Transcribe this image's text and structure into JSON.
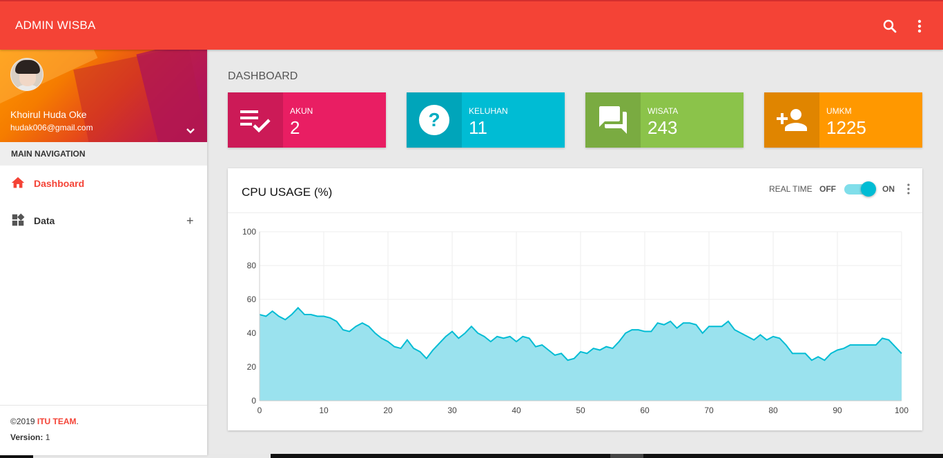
{
  "topbar": {
    "title": "ADMIN WISBA",
    "search_icon": "search-icon",
    "more_icon": "more-vert-icon",
    "bg_color": "#f44336"
  },
  "sidebar": {
    "user": {
      "name": "Khoirul Huda Oke",
      "email": "hudak006@gmail.com"
    },
    "nav_header": "MAIN NAVIGATION",
    "items": [
      {
        "label": "Dashboard",
        "icon": "home-icon",
        "active": true
      },
      {
        "label": "Data",
        "icon": "widgets-icon",
        "expand": "+"
      }
    ],
    "legal": {
      "copyright": "©2019 ",
      "brand": "ITU TEAM",
      "period": ".",
      "version_label": "Version:",
      "version_value": " 1"
    }
  },
  "main": {
    "page_title": "DASHBOARD",
    "info_boxes": [
      {
        "label": "AKUN",
        "value": "2",
        "color": "#e91e63",
        "icon": "playlist-check-icon"
      },
      {
        "label": "KELUHAN",
        "value": "11",
        "color": "#00bcd4",
        "icon": "help-icon"
      },
      {
        "label": "WISATA",
        "value": "243",
        "color": "#8bc34a",
        "icon": "forum-icon"
      },
      {
        "label": "UMKM",
        "value": "1225",
        "color": "#ff9800",
        "icon": "person-add-icon"
      }
    ],
    "cpu_card": {
      "title": "CPU USAGE (%)",
      "realtime_label": "REAL TIME",
      "off_label": "OFF",
      "on_label": "ON",
      "switch_on": true
    }
  },
  "chart_data": {
    "type": "area",
    "title": "",
    "xlabel": "",
    "ylabel": "",
    "xlim": [
      0,
      100
    ],
    "ylim": [
      0,
      100
    ],
    "x_ticks": [
      0,
      10,
      20,
      30,
      40,
      50,
      60,
      70,
      80,
      90,
      100
    ],
    "y_ticks": [
      0,
      20,
      40,
      60,
      80,
      100
    ],
    "grid": true,
    "color": "#00bcd4",
    "fill_color": "#9ae2ee",
    "x": [
      0,
      1,
      2,
      3,
      4,
      5,
      6,
      7,
      8,
      9,
      10,
      11,
      12,
      13,
      14,
      15,
      16,
      17,
      18,
      19,
      20,
      21,
      22,
      23,
      24,
      25,
      26,
      27,
      28,
      29,
      30,
      31,
      32,
      33,
      34,
      35,
      36,
      37,
      38,
      39,
      40,
      41,
      42,
      43,
      44,
      45,
      46,
      47,
      48,
      49,
      50,
      51,
      52,
      53,
      54,
      55,
      56,
      57,
      58,
      59,
      60,
      61,
      62,
      63,
      64,
      65,
      66,
      67,
      68,
      69,
      70,
      71,
      72,
      73,
      74,
      75,
      76,
      77,
      78,
      79,
      80,
      81,
      82,
      83,
      84,
      85,
      86,
      87,
      88,
      89,
      90,
      91,
      92,
      93,
      94,
      95,
      96,
      97,
      98,
      99,
      100
    ],
    "y": [
      51,
      50,
      53,
      50,
      48,
      51,
      55,
      51,
      51,
      50,
      50,
      49,
      47,
      42,
      41,
      44,
      46,
      44,
      40,
      37,
      35,
      32,
      31,
      36,
      31,
      29,
      25,
      30,
      34,
      38,
      41,
      37,
      40,
      44,
      40,
      38,
      35,
      38,
      37,
      38,
      35,
      38,
      37,
      32,
      33,
      30,
      27,
      28,
      24,
      25,
      29,
      28,
      31,
      30,
      32,
      31,
      35,
      40,
      42,
      42,
      41,
      41,
      46,
      45,
      47,
      43,
      46,
      46,
      45,
      40,
      44,
      44,
      44,
      47,
      42,
      40,
      38,
      36,
      39,
      36,
      38,
      37,
      33,
      28,
      28,
      28,
      24,
      26,
      24,
      28,
      30,
      31,
      33,
      33,
      33,
      33,
      33,
      37,
      36,
      32,
      28
    ]
  }
}
